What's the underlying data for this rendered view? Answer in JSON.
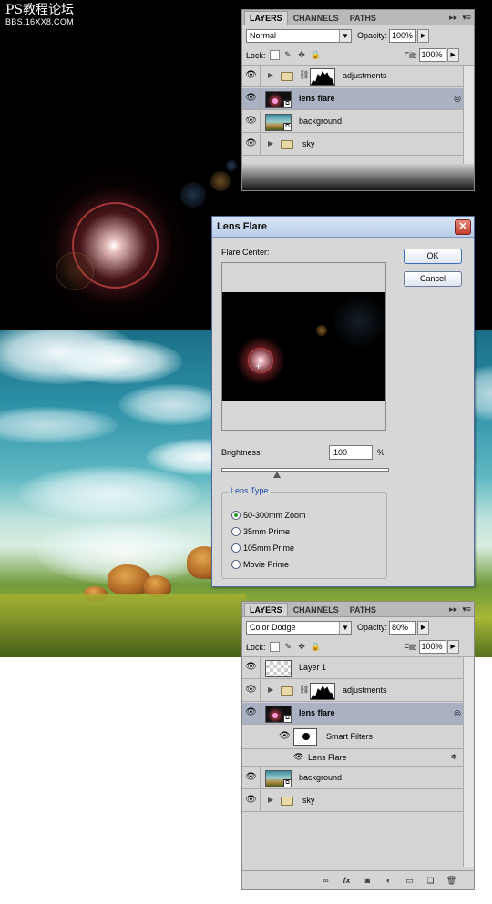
{
  "watermark": {
    "title": "PS教程论坛",
    "subtitle": "BBS.16XX8.COM"
  },
  "top_panel": {
    "tabs": [
      "LAYERS",
      "CHANNELS",
      "PATHS"
    ],
    "blend_mode": "Normal",
    "opacity_label": "Opacity:",
    "opacity": "100%",
    "lock_label": "Lock:",
    "fill_label": "Fill:",
    "fill": "100%",
    "layers": [
      {
        "name": "adjustments",
        "kind": "group-adjust"
      },
      {
        "name": "lens flare",
        "kind": "smart",
        "selected": true
      },
      {
        "name": "background",
        "kind": "image"
      },
      {
        "name": "sky",
        "kind": "group"
      }
    ]
  },
  "dialog": {
    "title": "Lens Flare",
    "close": "✕",
    "flare_center_label": "Flare Center:",
    "ok": "OK",
    "cancel": "Cancel",
    "brightness_label": "Brightness:",
    "brightness": "100",
    "percent": "%",
    "lens_type_label": "Lens Type",
    "lens_types": [
      "50-300mm Zoom",
      "35mm Prime",
      "105mm Prime",
      "Movie Prime"
    ],
    "selected_lens": 0,
    "brightness_slider": 0.33
  },
  "bottom_panel": {
    "tabs": [
      "LAYERS",
      "CHANNELS",
      "PATHS"
    ],
    "blend_mode": "Color Dodge",
    "opacity_label": "Opacity:",
    "opacity": "80%",
    "lock_label": "Lock:",
    "fill_label": "Fill:",
    "fill": "100%",
    "layers": [
      {
        "name": "Layer 1",
        "kind": "empty"
      },
      {
        "name": "adjustments",
        "kind": "group-adjust"
      },
      {
        "name": "lens flare",
        "kind": "smart",
        "selected": true
      },
      {
        "name": "Smart Filters",
        "kind": "smart-filters"
      },
      {
        "name": "Lens Flare",
        "kind": "filter"
      },
      {
        "name": "background",
        "kind": "image"
      },
      {
        "name": "sky",
        "kind": "group"
      }
    ],
    "fx_label": "fx"
  },
  "colors": {
    "panel": "#d4d4d4",
    "selected_layer": "#a9b1c3",
    "dialog_title": "#b9cde8",
    "accent_link": "#1a47a8"
  }
}
